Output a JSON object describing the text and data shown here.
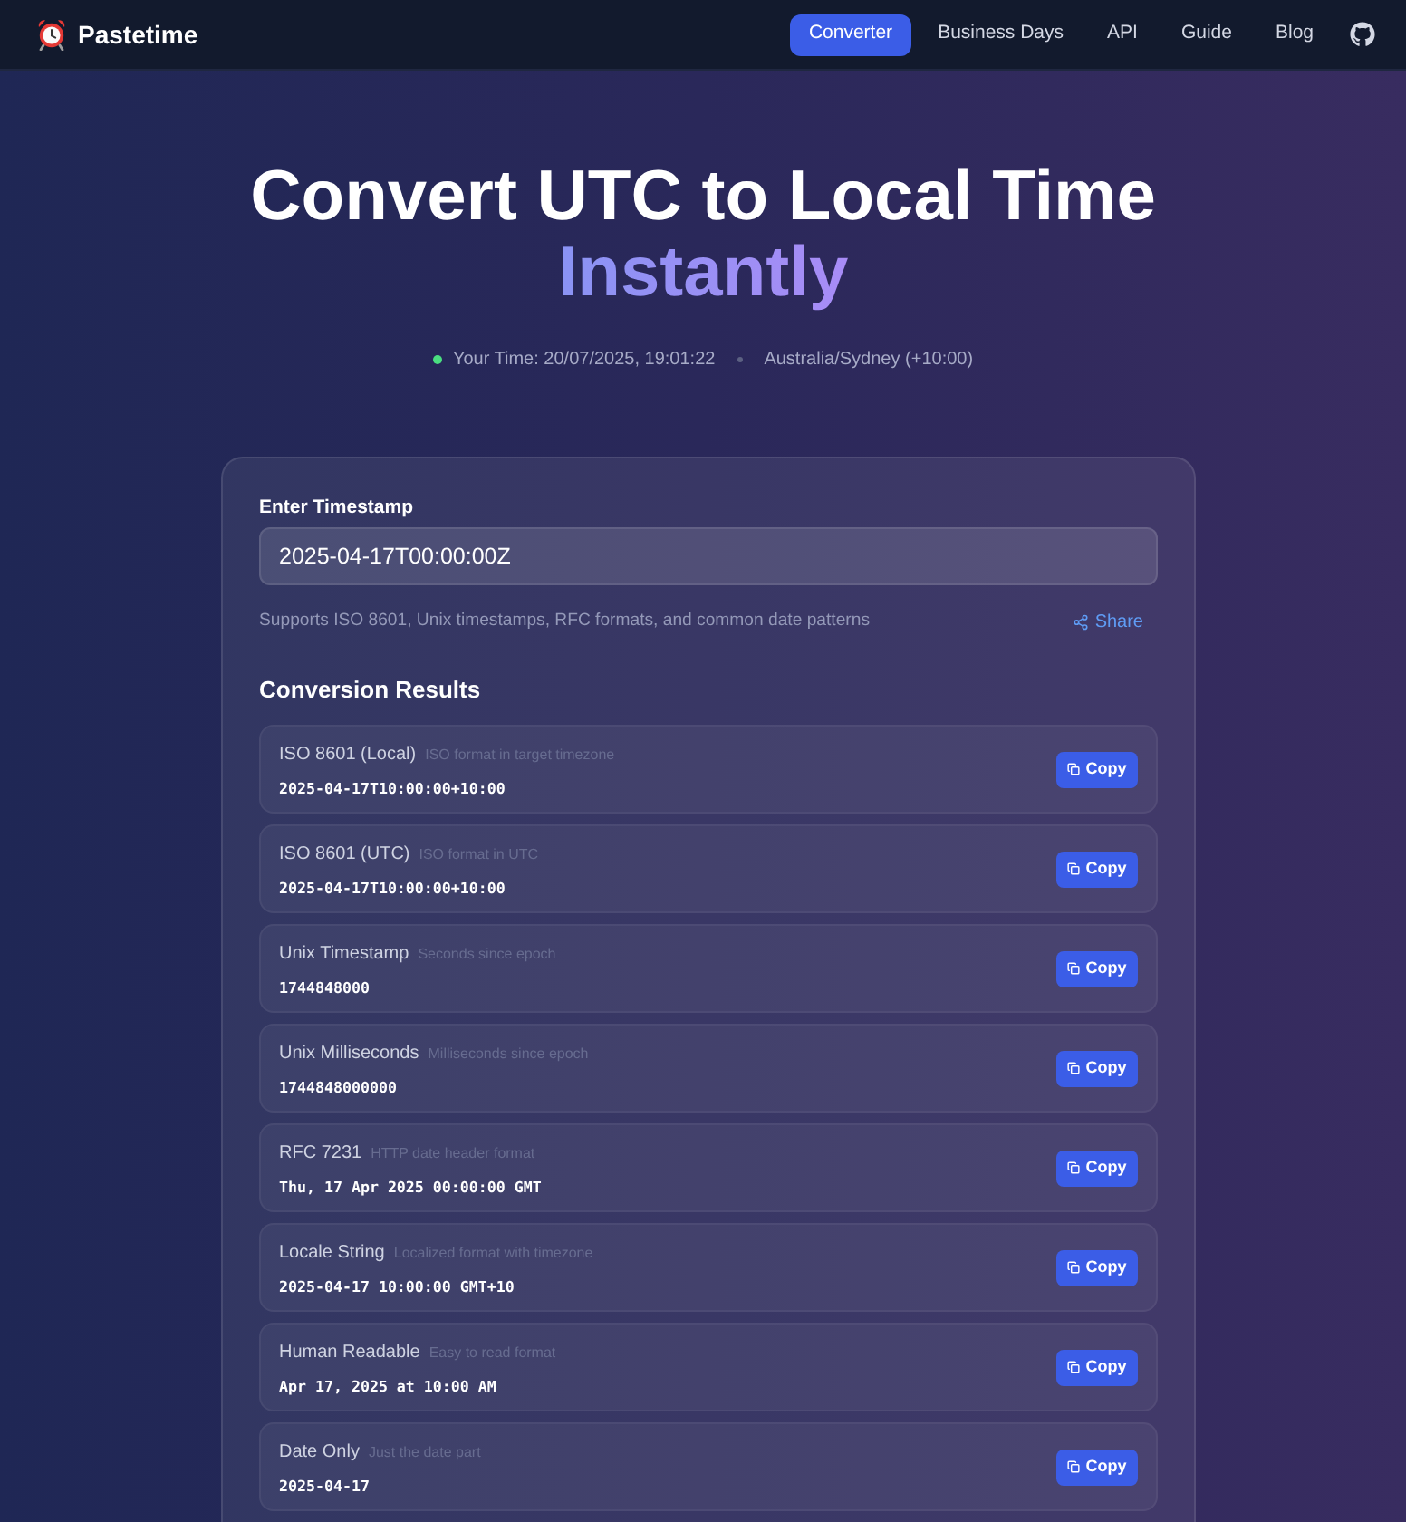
{
  "header": {
    "brand": "Pastetime",
    "nav": [
      {
        "label": "Converter",
        "selected": true
      },
      {
        "label": "Business Days",
        "selected": false
      },
      {
        "label": "API",
        "selected": false
      },
      {
        "label": "Guide",
        "selected": false
      },
      {
        "label": "Blog",
        "selected": false
      }
    ]
  },
  "hero": {
    "title": "Convert UTC to Local Time",
    "title_highlight": "Instantly",
    "your_time": "Your Time: 20/07/2025, 19:01:22",
    "timezone": "Australia/Sydney (+10:00)"
  },
  "converter": {
    "input_label": "Enter Timestamp",
    "input_value": "2025-04-17T00:00:00Z",
    "hint": "Supports ISO 8601, Unix timestamps, RFC formats, and common date patterns",
    "share": "Share",
    "results_title": "Conversion Results",
    "results": [
      {
        "label": "ISO 8601 (Local)",
        "description": "ISO format in target timezone",
        "value": "2025-04-17T10:00:00+10:00",
        "button": "Copy"
      },
      {
        "label": "ISO 8601 (UTC)",
        "description": "ISO format in UTC",
        "value": "2025-04-17T10:00:00+10:00",
        "button": "Copy"
      },
      {
        "label": "Unix Timestamp",
        "description": "Seconds since epoch",
        "value": "1744848000",
        "button": "Copy"
      },
      {
        "label": "Unix Milliseconds",
        "description": "Milliseconds since epoch",
        "value": "1744848000000",
        "button": "Copy"
      },
      {
        "label": "RFC 7231",
        "description": "HTTP date header format",
        "value": "Thu, 17 Apr 2025 00:00:00 GMT",
        "button": "Copy"
      },
      {
        "label": "Locale String",
        "description": "Localized format with timezone",
        "value": "2025-04-17 10:00:00 GMT+10",
        "button": "Copy"
      },
      {
        "label": "Human Readable",
        "description": "Easy to read format",
        "value": "Apr 17, 2025 at 10:00 AM",
        "button": "Copy"
      },
      {
        "label": "Date Only",
        "description": "Just the date part",
        "value": "2025-04-17",
        "button": "Copy"
      }
    ]
  }
}
